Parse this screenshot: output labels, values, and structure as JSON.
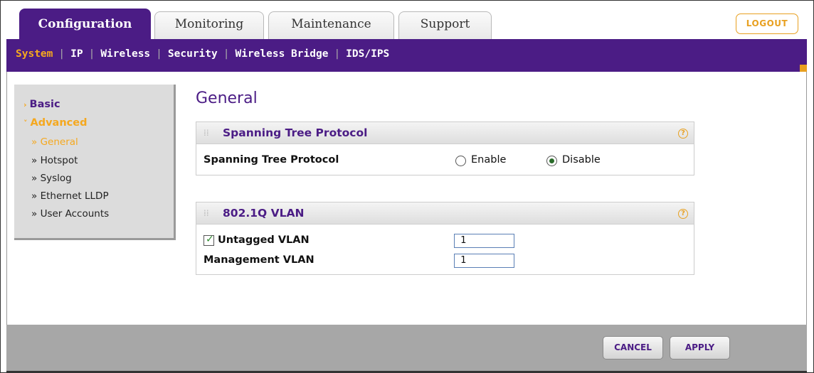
{
  "tabs": [
    {
      "label": "Configuration",
      "active": true
    },
    {
      "label": "Monitoring",
      "active": false
    },
    {
      "label": "Maintenance",
      "active": false
    },
    {
      "label": "Support",
      "active": false
    }
  ],
  "logout_label": "LOGOUT",
  "subnav": [
    "System",
    "IP",
    "Wireless",
    "Security",
    "Wireless Bridge",
    "IDS/IPS"
  ],
  "sidebar": {
    "basic": "Basic",
    "advanced": "Advanced",
    "items": [
      "General",
      "Hotspot",
      "Syslog",
      "Ethernet LLDP",
      "User Accounts"
    ]
  },
  "page_title": "General",
  "stp": {
    "title": "Spanning Tree Protocol",
    "label": "Spanning Tree Protocol",
    "enable": "Enable",
    "disable": "Disable",
    "selected": "Disable"
  },
  "vlan": {
    "title": "802.1Q VLAN",
    "untagged_label": "Untagged VLAN",
    "untagged_checked": true,
    "untagged_value": "1",
    "management_label": "Management VLAN",
    "management_value": "1"
  },
  "buttons": {
    "cancel": "CANCEL",
    "apply": "APPLY"
  },
  "colors": {
    "brand_purple": "#4b1c85",
    "accent_orange": "#f5a81f"
  }
}
